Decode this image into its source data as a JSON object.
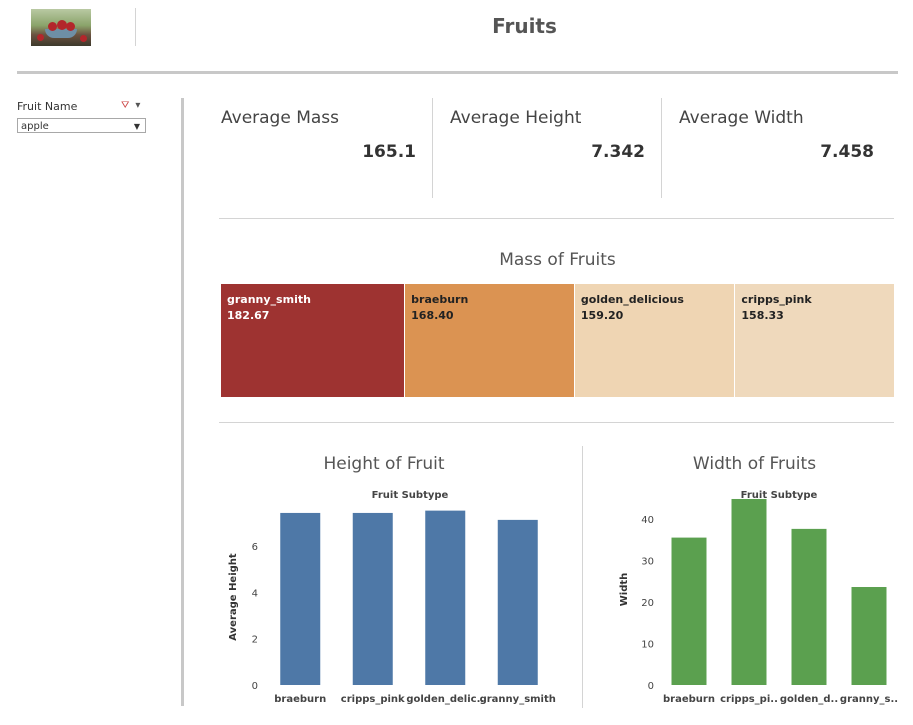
{
  "header": {
    "title": "Fruits"
  },
  "filter": {
    "label": "Fruit Name",
    "value": "apple"
  },
  "kpis": [
    {
      "label": "Average Mass",
      "value": "165.1"
    },
    {
      "label": "Average Height",
      "value": "7.342"
    },
    {
      "label": "Average Width",
      "value": "7.458"
    }
  ],
  "icons": {
    "header_image": "fruit-photo-icon",
    "filter_clear": "funnel-clear-icon",
    "filter_menu": "caret-down-icon",
    "select_arrow": "chevron-down-icon"
  },
  "chart_data": [
    {
      "type": "treemap",
      "title": "Mass of Fruits",
      "categories": [
        "granny_smith",
        "braeburn",
        "golden_delicious",
        "cripps_pink"
      ],
      "values": [
        182.67,
        168.4,
        159.2,
        158.33
      ],
      "labels": [
        "182.67",
        "168.40",
        "159.20",
        "158.33"
      ],
      "colors": [
        "#9e3331",
        "#db9352",
        "#efd5b3",
        "#efd9bc"
      ],
      "text_colors": [
        "#ffffff",
        "#222222",
        "#222222",
        "#222222"
      ]
    },
    {
      "type": "bar",
      "title": "Height of Fruit",
      "header": "Fruit Subtype",
      "ylabel": "Average Height",
      "categories": [
        "braeburn",
        "cripps_pink",
        "golden_delic..",
        "granny_smith"
      ],
      "values": [
        7.43,
        7.43,
        7.53,
        7.13
      ],
      "ylim": [
        0,
        7.6
      ],
      "yticks": [
        "0",
        "2",
        "4",
        "6"
      ],
      "ytick_values": [
        0,
        2,
        4,
        6
      ],
      "color": "#4e78a7"
    },
    {
      "type": "bar",
      "title": "Width of Fruits",
      "header": "Fruit Subtype",
      "ylabel": "Width",
      "categories": [
        "braeburn",
        "cripps_pi..",
        "golden_d..",
        "granny_s.."
      ],
      "values": [
        35.5,
        44.8,
        37.6,
        23.6
      ],
      "ylim": [
        0,
        46
      ],
      "yticks": [
        "0",
        "10",
        "20",
        "30",
        "40"
      ],
      "ytick_values": [
        0,
        10,
        20,
        30,
        40
      ],
      "color": "#5ba04f"
    }
  ]
}
